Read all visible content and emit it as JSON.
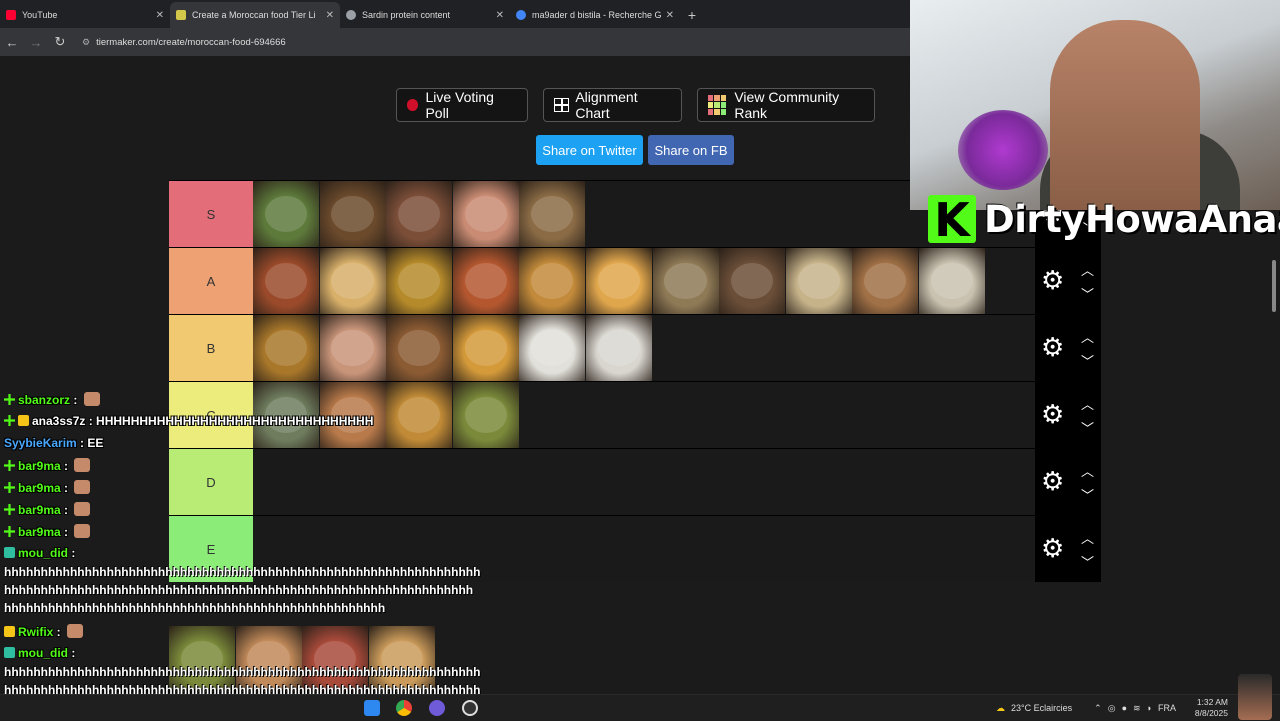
{
  "browser": {
    "tabs": [
      {
        "label": "YouTube",
        "icon": "youtube-icon",
        "color": "#ff0033"
      },
      {
        "label": "Create a Moroccan food Tier Li",
        "icon": "tiermaker-icon",
        "color": "#d4c84a"
      },
      {
        "label": "Sardin protein content",
        "icon": "globe-icon",
        "color": "#9aa0a6"
      },
      {
        "label": "ma9ader d bistila - Recherche G",
        "icon": "google-icon",
        "color": "#4285f4"
      }
    ],
    "new_tab": "+",
    "url": "tiermaker.com/create/moroccan-food-694666"
  },
  "toolbar": {
    "live_voting": "Live Voting Poll",
    "alignment": "Alignment Chart",
    "community": "View Community Rank",
    "share_twitter": "Share on Twitter",
    "share_fb": "Share on FB"
  },
  "tiers": [
    {
      "label": "S",
      "color": "#e36d78",
      "items": [
        "#5d7a3b",
        "#6b4a2c",
        "#7b4e38",
        "#c98b73",
        "#8a6b45"
      ]
    },
    {
      "label": "A",
      "color": "#eea172",
      "items": [
        "#9a4a2a",
        "#d8b06a",
        "#b58a2a",
        "#b4572f",
        "#c28a3a",
        "#e0a64c",
        "#8f7a56",
        "#6a4e38",
        "#c6b38a",
        "#a07046",
        "#c9c2b0"
      ]
    },
    {
      "label": "B",
      "color": "#f0c971",
      "items": [
        "#a8772a",
        "#c9957a",
        "#8b5b33",
        "#d49a3a",
        "#e2e0da",
        "#d9d6d0"
      ]
    },
    {
      "label": "C",
      "color": "#ecec7c",
      "items": [
        "#6f7d5e",
        "#b87a4a",
        "#c08a36",
        "#7a8a3a"
      ]
    },
    {
      "label": "D",
      "color": "#b8ec75",
      "items": []
    },
    {
      "label": "E",
      "color": "#8bec78",
      "items": []
    }
  ],
  "unranked": [
    "#7a8a3a",
    "#c18a5a",
    "#a84a3a",
    "#c99a5a"
  ],
  "streamer": {
    "name": "DirtyHowaAnaa"
  },
  "chat": [
    {
      "user": "sbanzorz",
      "badge": "green",
      "color": "#53fc18",
      "text": "",
      "emote": true
    },
    {
      "user": "ana3ss7z",
      "badge": "green-gold",
      "color": "#ffffff",
      "text": "HHHHHHHHHHHHHHHHHHHHHHHHHHHHHHHH",
      "emote": false
    },
    {
      "user": "SyybieKarim",
      "badge": "",
      "color": "#4aa8ff",
      "text": "EE",
      "emote": false
    },
    {
      "user": "bar9ma",
      "badge": "green",
      "color": "#53fc18",
      "text": "",
      "emote": true
    },
    {
      "user": "bar9ma",
      "badge": "green",
      "color": "#53fc18",
      "text": "",
      "emote": true
    },
    {
      "user": "bar9ma",
      "badge": "green",
      "color": "#53fc18",
      "text": "",
      "emote": true
    },
    {
      "user": "bar9ma",
      "badge": "green",
      "color": "#53fc18",
      "text": "",
      "emote": true
    },
    {
      "user": "mou_did",
      "badge": "teal",
      "color": "#53fc18",
      "text": "",
      "emote": false
    }
  ],
  "long1": "hhhhhhhhhhhhhhhhhhhhhhhhhhhhhhhhhhhhhhhhhhhhhhhhhhhhhhhhhhhhhhhhh",
  "long2": "hhhhhhhhhhhhhhhhhhhhhhhhhhhhhhhhhhhhhhhhhhhhhhhhhhhhhhhhhhhhhhhh",
  "long3": "hhhhhhhhhhhhhhhhhhhhhhhhhhhhhhhhhhhhhhhhhhhhhhhhhhhh",
  "chat2": [
    {
      "user": "Rwifix",
      "badge": "gold",
      "color": "#53fc18",
      "emote": true
    },
    {
      "user": "mou_did",
      "badge": "teal",
      "color": "#53fc18",
      "emote": false
    }
  ],
  "long4": "hhhhhhhhhhhhhhhhhhhhhhhhhhhhhhhhhhhhhhhhhhhhhhhhhhhhhhhhhhhhhhhhh",
  "long5": "hhhhhhhhhhhhhhhhhhhhhhhhhhhhhhhhhhhhhhhhhhhhhhhhhhhhhhhhhhhhhhhhh",
  "long6": "hhhhhhhhhhhhhhhhhhhhhhhhhhhhhhhhhhhhhhhhhhhhhhhhhhhhhhhh",
  "taskbar": {
    "weather": "23°C  Eclaircies",
    "lang": "FRA",
    "time": "1:32 AM",
    "date": "8/8/2025"
  }
}
